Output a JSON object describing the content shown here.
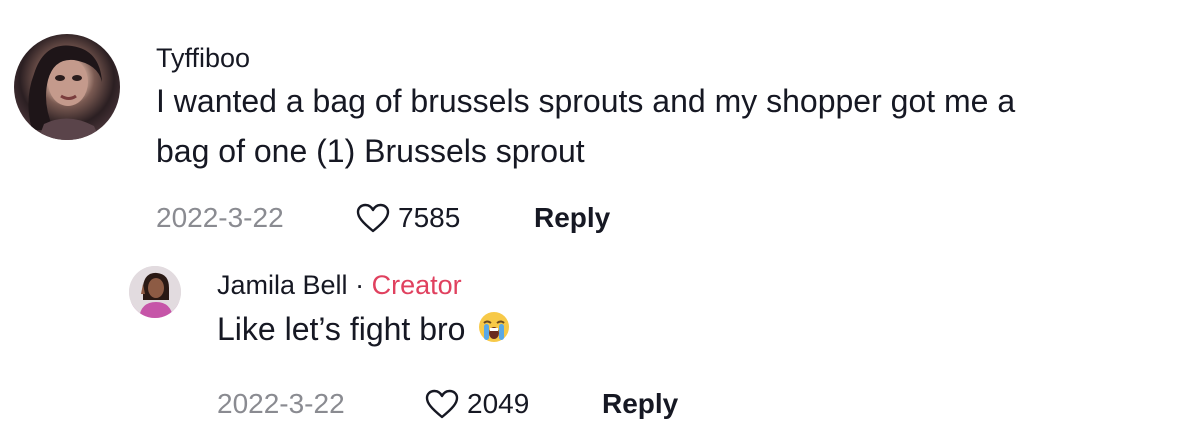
{
  "comments": [
    {
      "username": "Tyffiboo",
      "text_line1": "I wanted a bag of brussels sprouts and my shopper got me a",
      "text_line2": "bag of one (1) Brussels sprout",
      "date": "2022-3-22",
      "likes": "7585",
      "reply_label": "Reply",
      "avatar_icon": "user-avatar"
    }
  ],
  "reply": {
    "username": "Jamila Bell",
    "separator": "·",
    "badge": "Creator",
    "text": "Like let’s fight bro",
    "emoji_icon": "loudly-crying-face-icon",
    "date": "2022-3-22",
    "likes": "2049",
    "reply_label": "Reply",
    "avatar_icon": "creator-avatar"
  },
  "colors": {
    "creator_badge": "#e0415f",
    "muted_text": "#8a8b91",
    "primary_text": "#161823"
  }
}
